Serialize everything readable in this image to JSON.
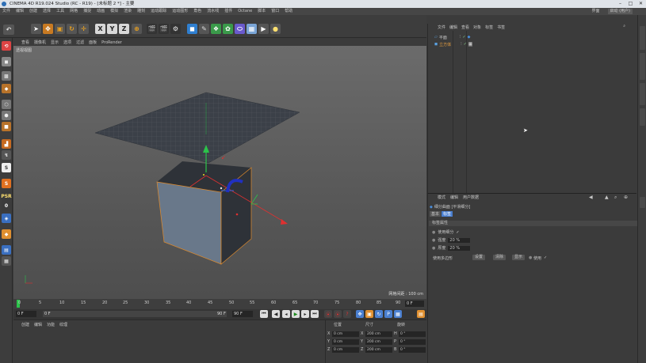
{
  "window": {
    "title": "CINEMA 4D R19.024 Studio (RC - R19) - [未标题 2 *] - 主要"
  },
  "menu": {
    "items": [
      "文件",
      "编辑",
      "创建",
      "选择",
      "工具",
      "网格",
      "捕捉",
      "动画",
      "模拟",
      "渲染",
      "雕刻",
      "运动跟踪",
      "运动图形",
      "角色",
      "流水线",
      "插件",
      "Octane",
      "脚本",
      "窗口",
      "帮助"
    ],
    "layout_label": "界面",
    "layout_value": "启动 (用户)"
  },
  "toolbar": {
    "axis_x": "X",
    "axis_y": "Y",
    "axis_z": "Z"
  },
  "viewport": {
    "menu": [
      "查看",
      "摄像机",
      "显示",
      "选项",
      "过滤",
      "面板",
      "ProRender"
    ],
    "label": "透视视图",
    "grid_scale": "网格间距 : 100 cm"
  },
  "timeline": {
    "ticks": [
      "0",
      "5",
      "10",
      "15",
      "20",
      "25",
      "30",
      "35",
      "40",
      "45",
      "50",
      "55",
      "60",
      "65",
      "70",
      "75",
      "80",
      "85",
      "90"
    ],
    "current_frame": "0 F"
  },
  "frameline": {
    "start": "0 F",
    "start2": "0 F",
    "end": "90 F",
    "end2": "90 F"
  },
  "material_panel": {
    "menu": [
      "创建",
      "编辑",
      "功能",
      "纹理"
    ]
  },
  "coord_panel": {
    "headers": [
      "位置",
      "尺寸",
      "旋转"
    ],
    "rows": [
      {
        "axis": "X",
        "pos": "0 cm",
        "size_axis": "X",
        "size": "200 cm",
        "rot_axis": "H",
        "rot": "0 °"
      },
      {
        "axis": "Y",
        "pos": "0 cm",
        "size_axis": "Y",
        "size": "200 cm",
        "rot_axis": "P",
        "rot": "0 °"
      },
      {
        "axis": "Z",
        "pos": "0 cm",
        "size_axis": "Z",
        "size": "200 cm",
        "rot_axis": "B",
        "rot": "0 °"
      }
    ]
  },
  "object_panel": {
    "menu": [
      "文件",
      "编辑",
      "查看",
      "对象",
      "标签",
      "书签"
    ],
    "objects": [
      {
        "name": "平面"
      },
      {
        "name": "立方体"
      }
    ]
  },
  "attr_panel": {
    "menu": [
      "模式",
      "编辑",
      "用户数据"
    ],
    "tag_title": "细分曲面 [平滑细分]",
    "tabs": [
      "基本",
      "标签"
    ],
    "section": "标签属性",
    "props": [
      {
        "label": "使用细分",
        "value": "✓"
      },
      {
        "label": "强度",
        "value": "20 %"
      },
      {
        "label": "厚度",
        "value": "20 %"
      }
    ],
    "select_label": "使用多边形",
    "buttons": [
      "设置",
      "清除",
      "显示"
    ],
    "checkbox_label": "使用"
  }
}
